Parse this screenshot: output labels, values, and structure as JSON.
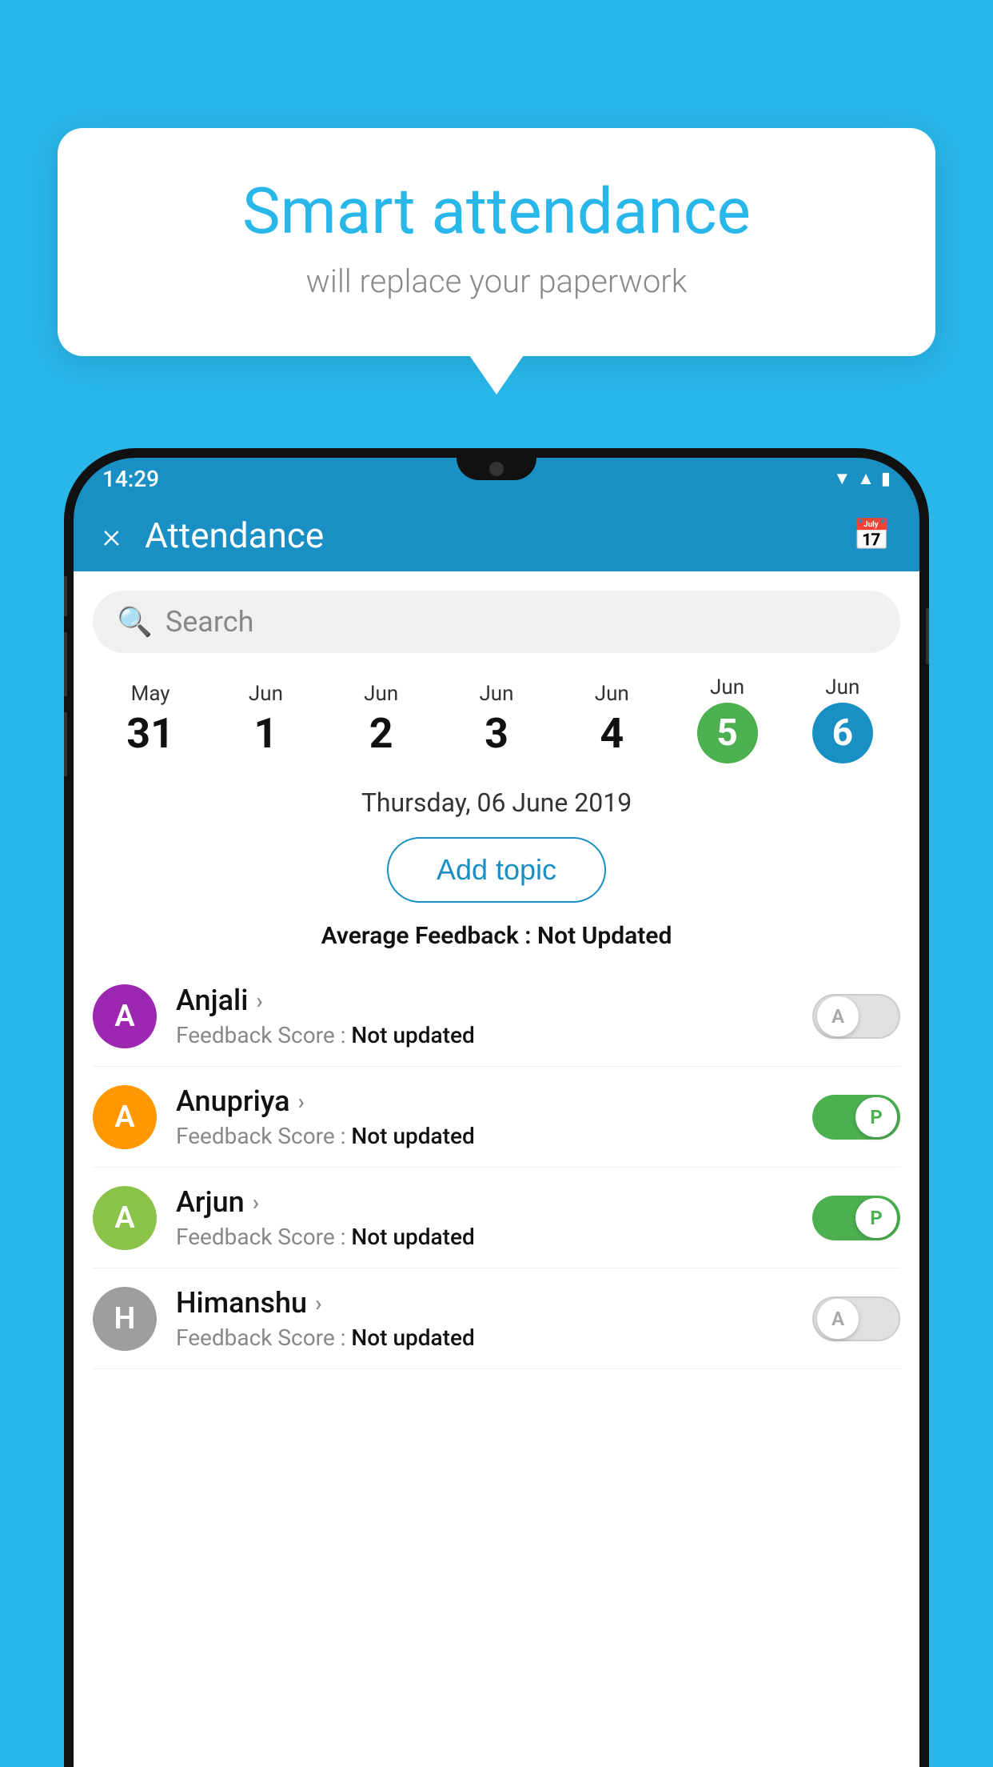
{
  "background_color": "#29b6e8",
  "bubble": {
    "title": "Smart attendance",
    "subtitle": "will replace your paperwork"
  },
  "status_bar": {
    "time": "14:29",
    "icons": [
      "wifi",
      "signal",
      "battery"
    ]
  },
  "header": {
    "title": "Attendance",
    "close_label": "×",
    "calendar_icon": "📅"
  },
  "search": {
    "placeholder": "Search"
  },
  "dates": [
    {
      "month": "May",
      "day": "31",
      "state": "normal"
    },
    {
      "month": "Jun",
      "day": "1",
      "state": "normal"
    },
    {
      "month": "Jun",
      "day": "2",
      "state": "normal"
    },
    {
      "month": "Jun",
      "day": "3",
      "state": "normal"
    },
    {
      "month": "Jun",
      "day": "4",
      "state": "normal"
    },
    {
      "month": "Jun",
      "day": "5",
      "state": "today"
    },
    {
      "month": "Jun",
      "day": "6",
      "state": "selected"
    }
  ],
  "selected_date_label": "Thursday, 06 June 2019",
  "add_topic_label": "Add topic",
  "avg_feedback_label": "Average Feedback : ",
  "avg_feedback_value": "Not Updated",
  "students": [
    {
      "name": "Anjali",
      "avatar_letter": "A",
      "avatar_color": "#9c27b0",
      "feedback_label": "Feedback Score : ",
      "feedback_value": "Not updated",
      "toggle": "off",
      "toggle_label": "A"
    },
    {
      "name": "Anupriya",
      "avatar_letter": "A",
      "avatar_color": "#ff9800",
      "feedback_label": "Feedback Score : ",
      "feedback_value": "Not updated",
      "toggle": "on",
      "toggle_label": "P"
    },
    {
      "name": "Arjun",
      "avatar_letter": "A",
      "avatar_color": "#8bc34a",
      "feedback_label": "Feedback Score : ",
      "feedback_value": "Not updated",
      "toggle": "on",
      "toggle_label": "P"
    },
    {
      "name": "Himanshu",
      "avatar_letter": "H",
      "avatar_color": "#9e9e9e",
      "feedback_label": "Feedback Score : ",
      "feedback_value": "Not updated",
      "toggle": "off",
      "toggle_label": "A"
    }
  ]
}
